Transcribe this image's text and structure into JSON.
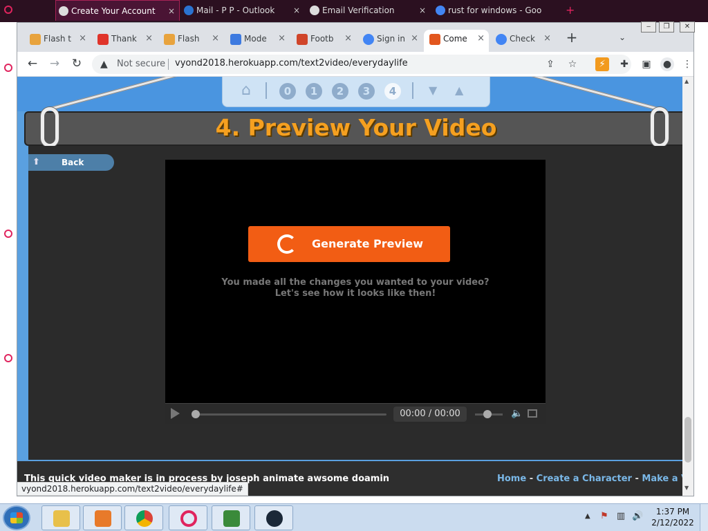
{
  "background_window": {
    "tabs": [
      {
        "title": "Create Your Account",
        "active": true
      },
      {
        "title": "Mail - P P - Outlook",
        "active": false
      },
      {
        "title": "Email Verification",
        "active": false
      },
      {
        "title": "rust for windows - Goo",
        "active": false
      }
    ],
    "close": "×",
    "new_tab": "+"
  },
  "browser": {
    "tabs": [
      {
        "title": "Flash t",
        "favicon_color": "#e8a33d",
        "active": false
      },
      {
        "title": "Thank",
        "favicon_color": "#e0342a",
        "active": false
      },
      {
        "title": "Flash",
        "favicon_color": "#e8a33d",
        "active": false
      },
      {
        "title": "Mode",
        "favicon_color": "#3d7ae0",
        "active": false
      },
      {
        "title": "Footb",
        "favicon_color": "#d0452a",
        "active": false
      },
      {
        "title": "Sign in",
        "favicon_color": "#4285f4",
        "active": false
      },
      {
        "title": "Come",
        "favicon_color": "#e2571f",
        "active": true
      },
      {
        "title": "Check",
        "favicon_color": "#4285f4",
        "active": false
      }
    ],
    "tab_close": "×",
    "new_tab": "+",
    "security_label": "Not secure",
    "url": "vyond2018.herokuapp.com/text2video/everydaylife",
    "status_url": "vyond2018.herokuapp.com/text2video/everydaylife#"
  },
  "page": {
    "step_nav": {
      "steps": [
        "0",
        "1",
        "2",
        "3",
        "4"
      ],
      "current_step": "4"
    },
    "title": "4. Preview Your Video",
    "back_label": "Back",
    "generate_label": "Generate Preview",
    "message_line1": "You made all the changes you wanted to your video?",
    "message_line2": "Let's see how it looks like then!",
    "time_display": "00:00 / 00:00",
    "footer_text": "This quick video maker is in process by joseph animate awsome doamin",
    "footer_links": {
      "home": "Home",
      "create_character": "Create a Character",
      "make_video": "Make a Video",
      "separator": "-"
    }
  },
  "taskbar": {
    "time": "1:37 PM",
    "date": "2/12/2022",
    "pinned": [
      {
        "name": "file-explorer",
        "color": "#e8c04a"
      },
      {
        "name": "media-player",
        "color": "#e87a2a"
      },
      {
        "name": "chrome",
        "color": "#4caf50"
      },
      {
        "name": "opera",
        "color": "#e0245e"
      },
      {
        "name": "task-manager",
        "color": "#3a8a3a"
      },
      {
        "name": "steam",
        "color": "#1b2838"
      }
    ]
  },
  "colors": {
    "accent_orange": "#f25d14",
    "title_orange": "#f5a020",
    "link_blue": "#7ab8e8"
  }
}
